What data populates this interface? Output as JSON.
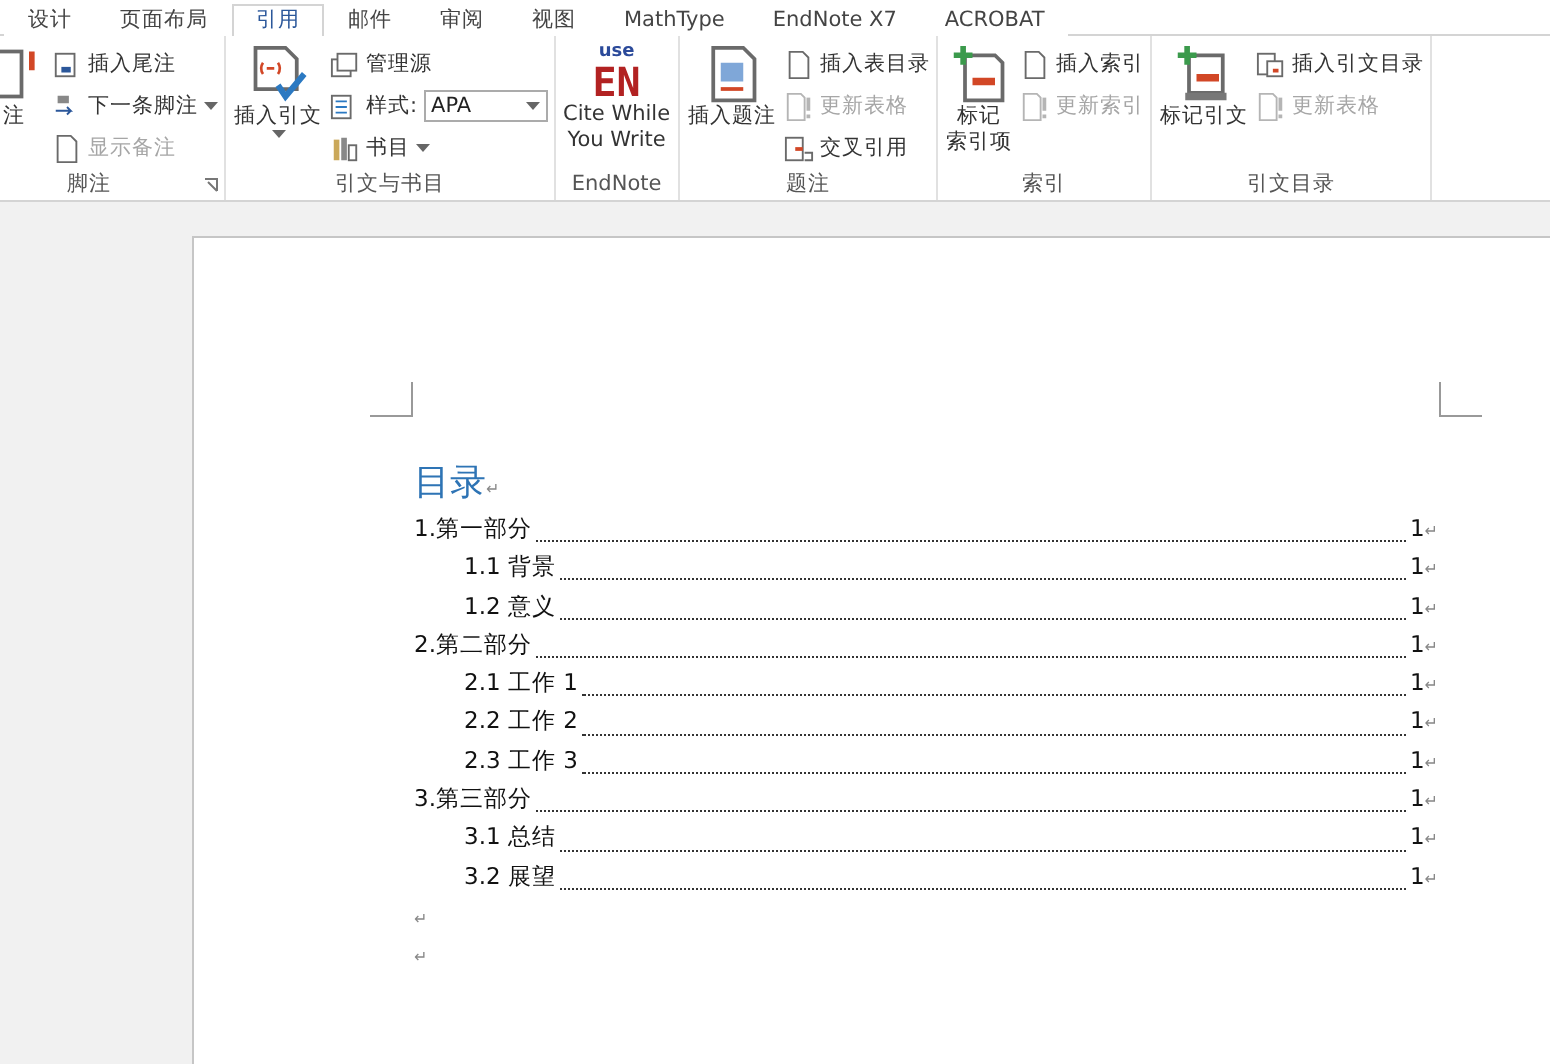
{
  "tabs": [
    {
      "label": "设计",
      "selected": false
    },
    {
      "label": "页面布局",
      "selected": false
    },
    {
      "label": "引用",
      "selected": true
    },
    {
      "label": "邮件",
      "selected": false
    },
    {
      "label": "审阅",
      "selected": false
    },
    {
      "label": "视图",
      "selected": false
    },
    {
      "label": "MathType",
      "selected": false
    },
    {
      "label": "EndNote X7",
      "selected": false
    },
    {
      "label": "ACROBAT",
      "selected": false
    }
  ],
  "ribbon": {
    "groups": [
      {
        "label": "脚注",
        "large": [
          {
            "label": "注"
          }
        ],
        "small": [
          {
            "kind": "button",
            "label": "插入尾注",
            "disabled": false
          },
          {
            "kind": "button",
            "label": "下一条脚注",
            "disabled": false
          },
          {
            "kind": "button",
            "label": "显示备注",
            "disabled": true
          }
        ]
      },
      {
        "label": "引文与书目",
        "large": [
          {
            "label": "插入引文"
          }
        ],
        "small": [
          {
            "kind": "button",
            "label": "管理源",
            "disabled": false
          },
          {
            "kind": "combo",
            "label": "样式:",
            "value": "APA",
            "disabled": false
          },
          {
            "kind": "button",
            "label": "书目",
            "disabled": false
          }
        ]
      },
      {
        "label": "EndNote",
        "large": [
          {
            "label": "Cite While\nYou Write",
            "logo_top": "use",
            "logo": "EN"
          }
        ]
      },
      {
        "label": "题注",
        "large": [
          {
            "label": "插入题注"
          }
        ],
        "small": [
          {
            "kind": "button",
            "label": "插入表目录",
            "disabled": false
          },
          {
            "kind": "button",
            "label": "更新表格",
            "disabled": true
          },
          {
            "kind": "button",
            "label": "交叉引用",
            "disabled": false
          }
        ]
      },
      {
        "label": "索引",
        "large": [
          {
            "label_lines": [
              "标记",
              "索引项"
            ]
          }
        ],
        "small": [
          {
            "kind": "button",
            "label": "插入索引",
            "disabled": false
          },
          {
            "kind": "button",
            "label": "更新索引",
            "disabled": true
          }
        ]
      },
      {
        "label": "引文目录",
        "large": [
          {
            "label": "标记引文"
          }
        ],
        "small": [
          {
            "kind": "button",
            "label": "插入引文目录",
            "disabled": false
          },
          {
            "kind": "button",
            "label": "更新表格",
            "disabled": true
          }
        ]
      }
    ]
  },
  "document": {
    "title": "目录",
    "paragraph_mark": "↵",
    "toc": [
      {
        "text": "1.第一部分",
        "page": "1",
        "children": [
          {
            "text": "1.1 背景",
            "page": "1"
          },
          {
            "text": "1.2 意义",
            "page": "1"
          }
        ]
      },
      {
        "text": "2.第二部分",
        "page": "1",
        "children": [
          {
            "text": "2.1 工作 1",
            "page": "1"
          },
          {
            "text": "2.2 工作 2",
            "page": "1"
          },
          {
            "text": "2.3 工作 3",
            "page": "1"
          }
        ]
      },
      {
        "text": "3.第三部分",
        "page": "1",
        "children": [
          {
            "text": "3.1 总结",
            "page": "1"
          },
          {
            "text": "3.2 展望",
            "page": "1"
          }
        ]
      }
    ],
    "empty_paragraphs": [
      "↵",
      "↵"
    ]
  }
}
